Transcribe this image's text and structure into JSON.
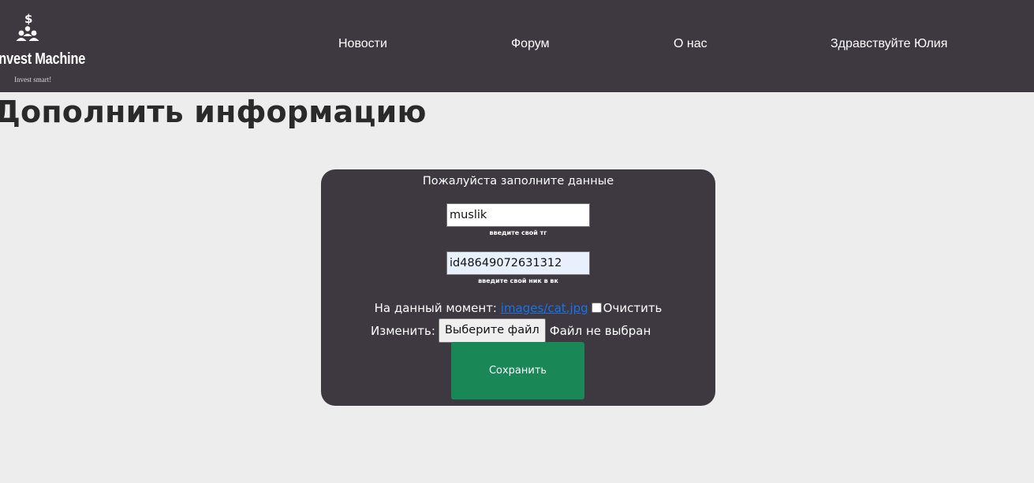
{
  "brand": {
    "name": "Invest Machine",
    "tagline": "Invest smart!"
  },
  "nav": {
    "news": "Новости",
    "forum": "Форум",
    "about": "О нас",
    "greeting": "Здравствуйте Юлия"
  },
  "page": {
    "title": "Дополнить информацию"
  },
  "form": {
    "title": "Пожалуйста заполните данные",
    "tg": {
      "value": "muslik",
      "hint": "введите свой тг"
    },
    "vk": {
      "value": "id48649072631312",
      "hint": "введите свой ник в вк"
    },
    "current_label": "На данный момент:",
    "current_file": "images/cat.jpg",
    "clear_label": "Очистить",
    "change_label": "Изменить:",
    "file_button": "Выберите файл",
    "file_status": "Файл не выбран",
    "save_button": "Сохранить"
  },
  "colors": {
    "header_bg": "#3e3840",
    "page_bg": "#ededed",
    "card_bg": "#3e3840",
    "save_bg": "#1a8757",
    "link": "#1a73e8",
    "autofill_bg": "#e8f0fe"
  }
}
